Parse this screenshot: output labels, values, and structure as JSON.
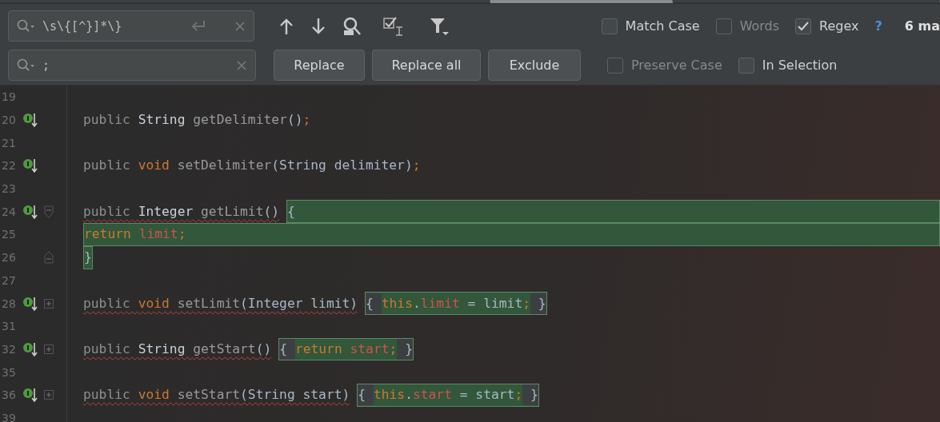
{
  "tabs": [
    {
      "selected": false
    },
    {
      "selected": true
    },
    {
      "selected": false
    }
  ],
  "find": {
    "search_value": "\\s\\{[^}]*\\}",
    "replace_value": ";",
    "match_count": "6 ma"
  },
  "buttons": [
    "Replace",
    "Replace all",
    "Exclude"
  ],
  "options": [
    {
      "label": "Match Case",
      "checked": false,
      "disabled": false
    },
    {
      "label": "Words",
      "checked": false,
      "disabled": true
    },
    {
      "label": "Regex",
      "checked": true,
      "disabled": false
    }
  ],
  "regex_help": "?",
  "replace_options": [
    {
      "label": "Preserve Case",
      "checked": false,
      "disabled": true
    },
    {
      "label": "In Selection",
      "checked": false,
      "disabled": false
    }
  ],
  "lines": [
    {
      "number": "19"
    },
    {
      "number": "20",
      "implements": true,
      "error": false,
      "tokens": [
        {
          "text": "public ",
          "kind": "mod"
        },
        {
          "text": "String ",
          "kind": "type"
        },
        {
          "text": "getDelimiter",
          "kind": "name"
        },
        {
          "text": "()",
          "kind": "plain"
        },
        {
          "text": ";",
          "kind": "semi"
        }
      ]
    },
    {
      "number": "21"
    },
    {
      "number": "22",
      "implements": true,
      "error": false,
      "tokens": [
        {
          "text": "public ",
          "kind": "mod"
        },
        {
          "text": "void ",
          "kind": "kw"
        },
        {
          "text": "setDelimiter",
          "kind": "name"
        },
        {
          "text": "(String delimiter)",
          "kind": "plain"
        },
        {
          "text": ";",
          "kind": "semi"
        }
      ]
    },
    {
      "number": "23"
    },
    {
      "number": "24",
      "implements": true,
      "fold_start": true,
      "error": true,
      "tokens": [
        {
          "text": "public ",
          "kind": "mod"
        },
        {
          "text": "Integer ",
          "kind": "type"
        },
        {
          "text": "getLimit",
          "kind": "name"
        },
        {
          "text": "()",
          "kind": "plain"
        }
      ],
      "match": {
        "to_end": true,
        "tokens": [
          {
            "text": "{",
            "kind": "plain"
          }
        ]
      }
    },
    {
      "number": "25",
      "match": {
        "to_end": true,
        "tokens": [
          {
            "text": "return ",
            "kind": "kw"
          },
          {
            "text": "limit",
            "kind": "field"
          },
          {
            "text": ";",
            "kind": "semi"
          }
        ]
      }
    },
    {
      "number": "26",
      "fold_end": true,
      "match": {
        "to_end": false,
        "tokens": [
          {
            "text": "}",
            "kind": "plain"
          }
        ]
      }
    },
    {
      "number": "27"
    },
    {
      "number": "28",
      "implements": true,
      "collapsed": true,
      "error": true,
      "tokens": [
        {
          "text": "public ",
          "kind": "mod"
        },
        {
          "text": "void ",
          "kind": "kw"
        },
        {
          "text": "setLimit",
          "kind": "name"
        },
        {
          "text": "(Integer limit)",
          "kind": "plain"
        }
      ],
      "match": {
        "to_end": false,
        "tokens": [
          {
            "text": "{ ",
            "kind": "fold"
          },
          {
            "text": "this",
            "kind": "kw"
          },
          {
            "text": ".",
            "kind": "plain"
          },
          {
            "text": "limit",
            "kind": "field"
          },
          {
            "text": " = limit",
            "kind": "plain"
          },
          {
            "text": ";",
            "kind": "semi"
          },
          {
            "text": " }",
            "kind": "fold"
          }
        ]
      }
    },
    {
      "number": "31"
    },
    {
      "number": "32",
      "implements": true,
      "collapsed": true,
      "error": true,
      "tokens": [
        {
          "text": "public ",
          "kind": "mod"
        },
        {
          "text": "String ",
          "kind": "type"
        },
        {
          "text": "getStart",
          "kind": "name"
        },
        {
          "text": "()",
          "kind": "plain"
        }
      ],
      "match": {
        "to_end": false,
        "tokens": [
          {
            "text": "{ ",
            "kind": "fold"
          },
          {
            "text": "return ",
            "kind": "kw"
          },
          {
            "text": "start",
            "kind": "field"
          },
          {
            "text": ";",
            "kind": "semi"
          },
          {
            "text": " }",
            "kind": "fold"
          }
        ]
      }
    },
    {
      "number": "35"
    },
    {
      "number": "36",
      "implements": true,
      "collapsed": true,
      "error": true,
      "tokens": [
        {
          "text": "public ",
          "kind": "mod"
        },
        {
          "text": "void ",
          "kind": "kw"
        },
        {
          "text": "setStart",
          "kind": "name"
        },
        {
          "text": "(String start)",
          "kind": "plain"
        }
      ],
      "match": {
        "to_end": false,
        "tokens": [
          {
            "text": "{ ",
            "kind": "fold"
          },
          {
            "text": "this",
            "kind": "kw"
          },
          {
            "text": ".",
            "kind": "plain"
          },
          {
            "text": "start",
            "kind": "field"
          },
          {
            "text": " = start",
            "kind": "plain"
          },
          {
            "text": ";",
            "kind": "semi"
          },
          {
            "text": " }",
            "kind": "fold"
          }
        ]
      }
    },
    {
      "number": "39"
    }
  ]
}
